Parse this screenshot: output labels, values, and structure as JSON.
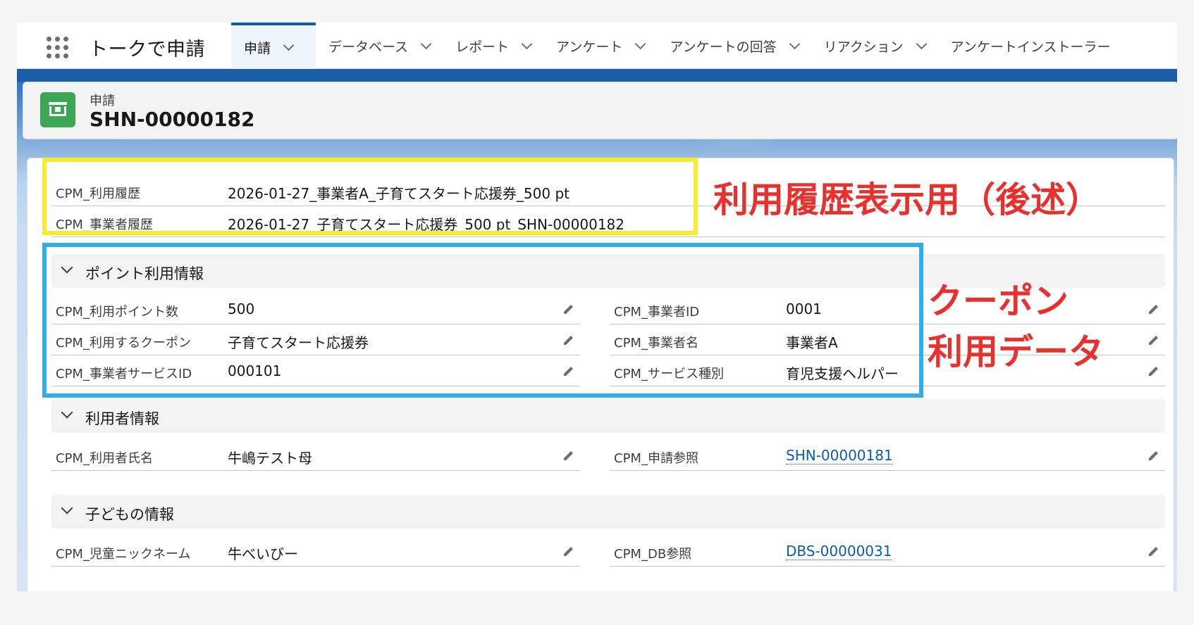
{
  "app": {
    "name": "トークで申請"
  },
  "tabs": [
    {
      "label": "申請",
      "active": true
    },
    {
      "label": "データベース"
    },
    {
      "label": "レポート"
    },
    {
      "label": "アンケート"
    },
    {
      "label": "アンケートの回答"
    },
    {
      "label": "リアクション"
    },
    {
      "label": "アンケートインストーラー"
    }
  ],
  "record": {
    "type": "申請",
    "title": "SHN-00000182",
    "icon": "application-form-icon",
    "icon_color": "#3ba755"
  },
  "history": [
    {
      "label": "CPM_利用履歴",
      "value": "2026-01-27_事業者A_子育てスタート応援券_500 pt"
    },
    {
      "label": "CPM_事業者履歴",
      "value": "2026-01-27_子育てスタート応援券_500 pt_SHN-00000182"
    }
  ],
  "sections": {
    "points": {
      "title": "ポイント利用情報",
      "fields": [
        {
          "label": "CPM_利用ポイント数",
          "value": "500"
        },
        {
          "label": "CPM_事業者ID",
          "value": "0001"
        },
        {
          "label": "CPM_利用するクーポン",
          "value": "子育てスタート応援券"
        },
        {
          "label": "CPM_事業者名",
          "value": "事業者A"
        },
        {
          "label": "CPM_事業者サービスID",
          "value": "000101"
        },
        {
          "label": "CPM_サービス種別",
          "value": "育児支援ヘルパー"
        }
      ]
    },
    "user": {
      "title": "利用者情報",
      "fields": [
        {
          "label": "CPM_利用者氏名",
          "value": "牛嶋テスト母"
        },
        {
          "label": "CPM_申請参照",
          "value": "SHN-00000181",
          "link": true
        }
      ]
    },
    "child": {
      "title": "子どもの情報",
      "fields": [
        {
          "label": "CPM_児童ニックネーム",
          "value": "牛べいびー"
        },
        {
          "label": "CPM_DB参照",
          "value": "DBS-00000031",
          "link": true
        }
      ]
    }
  },
  "annotations": {
    "history_note": "利用履歴表示用（後述）",
    "coupon_note_line1": "クーポン",
    "coupon_note_line2": "利用データ",
    "history_box_color": "#f7ec2e",
    "coupon_box_color": "#31aee9",
    "text_color": "#e8302d"
  },
  "colors": {
    "brand_blue": "#0b5cab",
    "link": "#0b5cab"
  }
}
